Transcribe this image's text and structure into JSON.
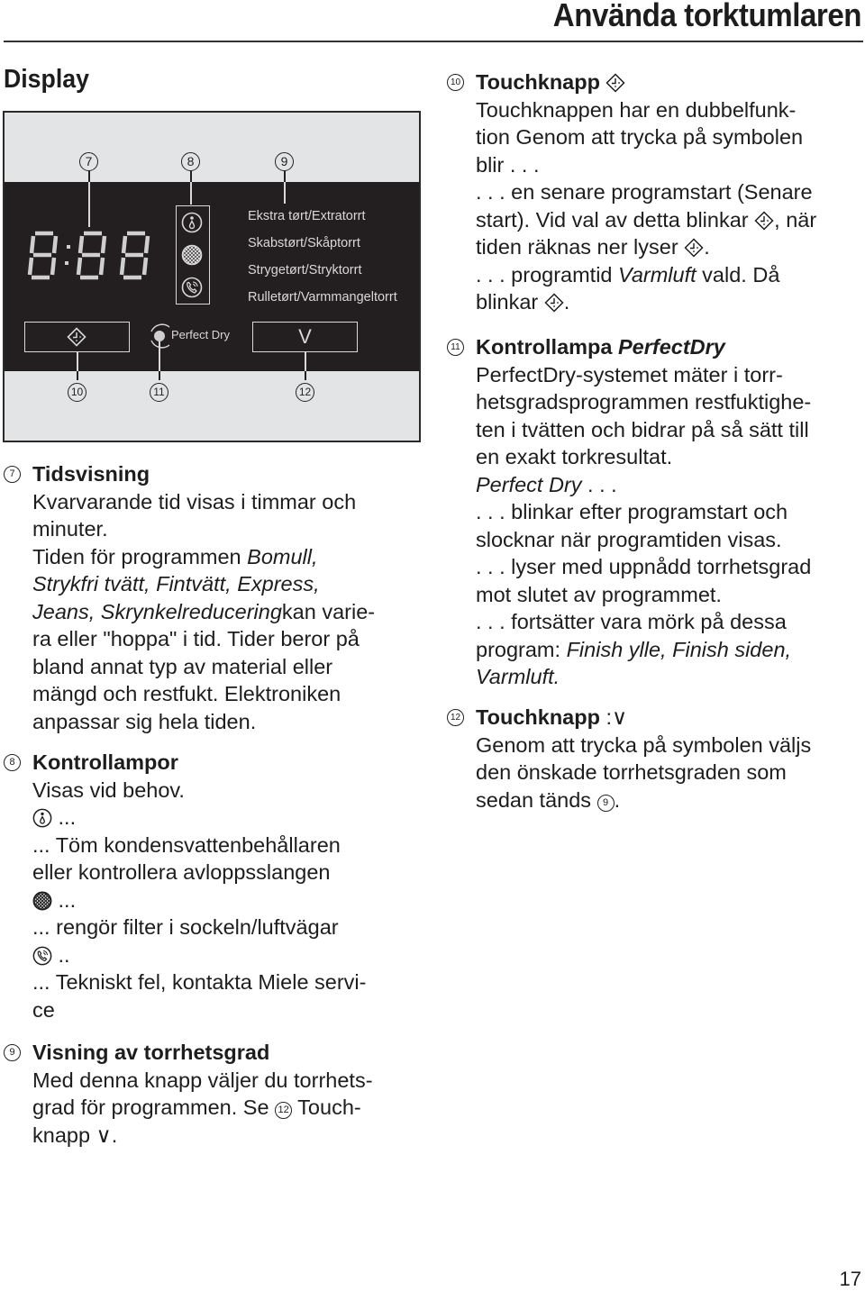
{
  "header": {
    "title": "Använda torktumlaren"
  },
  "section": {
    "title": "Display"
  },
  "panel": {
    "callouts": [
      "7",
      "8",
      "9",
      "10",
      "11",
      "12"
    ],
    "time_display": "8:88",
    "dryness_levels": [
      "Ekstra tørt/Extratorrt",
      "Skabstørt/Skåptorrt",
      "Strygetørt/Stryktorrt",
      "Rulletørt/Varmmangeltorrt"
    ],
    "lamp_icons": [
      "water-drain-icon",
      "filter-icon",
      "service-phone-icon"
    ],
    "timer_button_icon": "clock-diamond-icon",
    "perfect_dry_label": "Perfect Dry",
    "select_button_label": "V"
  },
  "items": {
    "item7": {
      "number": "7",
      "heading": "Tidsvisning",
      "lines": [
        "Kvarvarande tid visas i timmar och",
        "minuter.",
        "Tiden för programmen ",
        "Strykfri tvätt, Fintvätt, Express,",
        "Jeans, Skrynkelreducering",
        "ra eller \"hoppa\" i tid. Tider beror på",
        "bland annat typ av material eller",
        "mängd och restfukt. Elektroniken",
        "anpassar sig hela tiden."
      ],
      "italic_bomull": "Bomull,",
      "suffix_line5": "kan varie-"
    },
    "item8": {
      "number": "8",
      "heading": "Kontrollampor",
      "intro": "Visas vid behov.",
      "entries": [
        {
          "icon": "water-drain-icon",
          "lead": "...",
          "text": "... Töm kondensvattenbehållaren",
          "text2": "eller kontrollera avloppsslangen"
        },
        {
          "icon": "filter-icon",
          "lead": "...",
          "text": "... rengör filter i sockeln/luftvägar"
        },
        {
          "icon": "service-phone-icon",
          "lead": "..",
          "text": "... Tekniskt fel, kontakta Miele servi-",
          "text2": "ce"
        }
      ]
    },
    "item9": {
      "number": "9",
      "heading": "Visning av torrhetsgrad",
      "lines": [
        "Med denna knapp väljer du torrhets-",
        "grad för programmen. Se ",
        "knapp ∨."
      ],
      "ref_number": "12",
      "ref_suffix": " Touch-"
    },
    "item10": {
      "number": "10",
      "heading": "Touchknapp",
      "lines": [
        "Touchknappen har en dubbelfunk-",
        "tion Genom att trycka på symbolen",
        "blir . . .",
        ". . . en senare programstart (Senare",
        "start). Vid val av detta blinkar ",
        ", när",
        "tiden räknas ner lyser ",
        ". . . programtid ",
        "Varmluft",
        " vald. Då",
        "blinkar "
      ]
    },
    "item11": {
      "number": "11",
      "heading": "Kontrollampa ",
      "heading_italic": "PerfectDry",
      "lines": [
        "PerfectDry-systemet mäter i torr-",
        "hetsgradsprogrammen restfuktighe-",
        "ten i tvätten och bidrar på så sätt till",
        "en exakt torkresultat.",
        "Perfect Dry",
        " . . .",
        ". . . blinkar efter programstart och",
        "slocknar när programtiden visas.",
        ". . . lyser med uppnådd torrhetsgrad",
        "mot slutet av programmet.",
        ". . . fortsätter vara mörk på dessa",
        "program: ",
        "Finish ylle, Finish siden,",
        "Varmluft."
      ]
    },
    "item12": {
      "number": "12",
      "heading": "Touchknapp",
      "heading_suffix": " :∨",
      "lines": [
        "Genom att trycka på symbolen väljs",
        "den önskade torrhetsgraden som",
        "sedan tänds "
      ],
      "ref_number": "9"
    }
  },
  "page_number": "17"
}
